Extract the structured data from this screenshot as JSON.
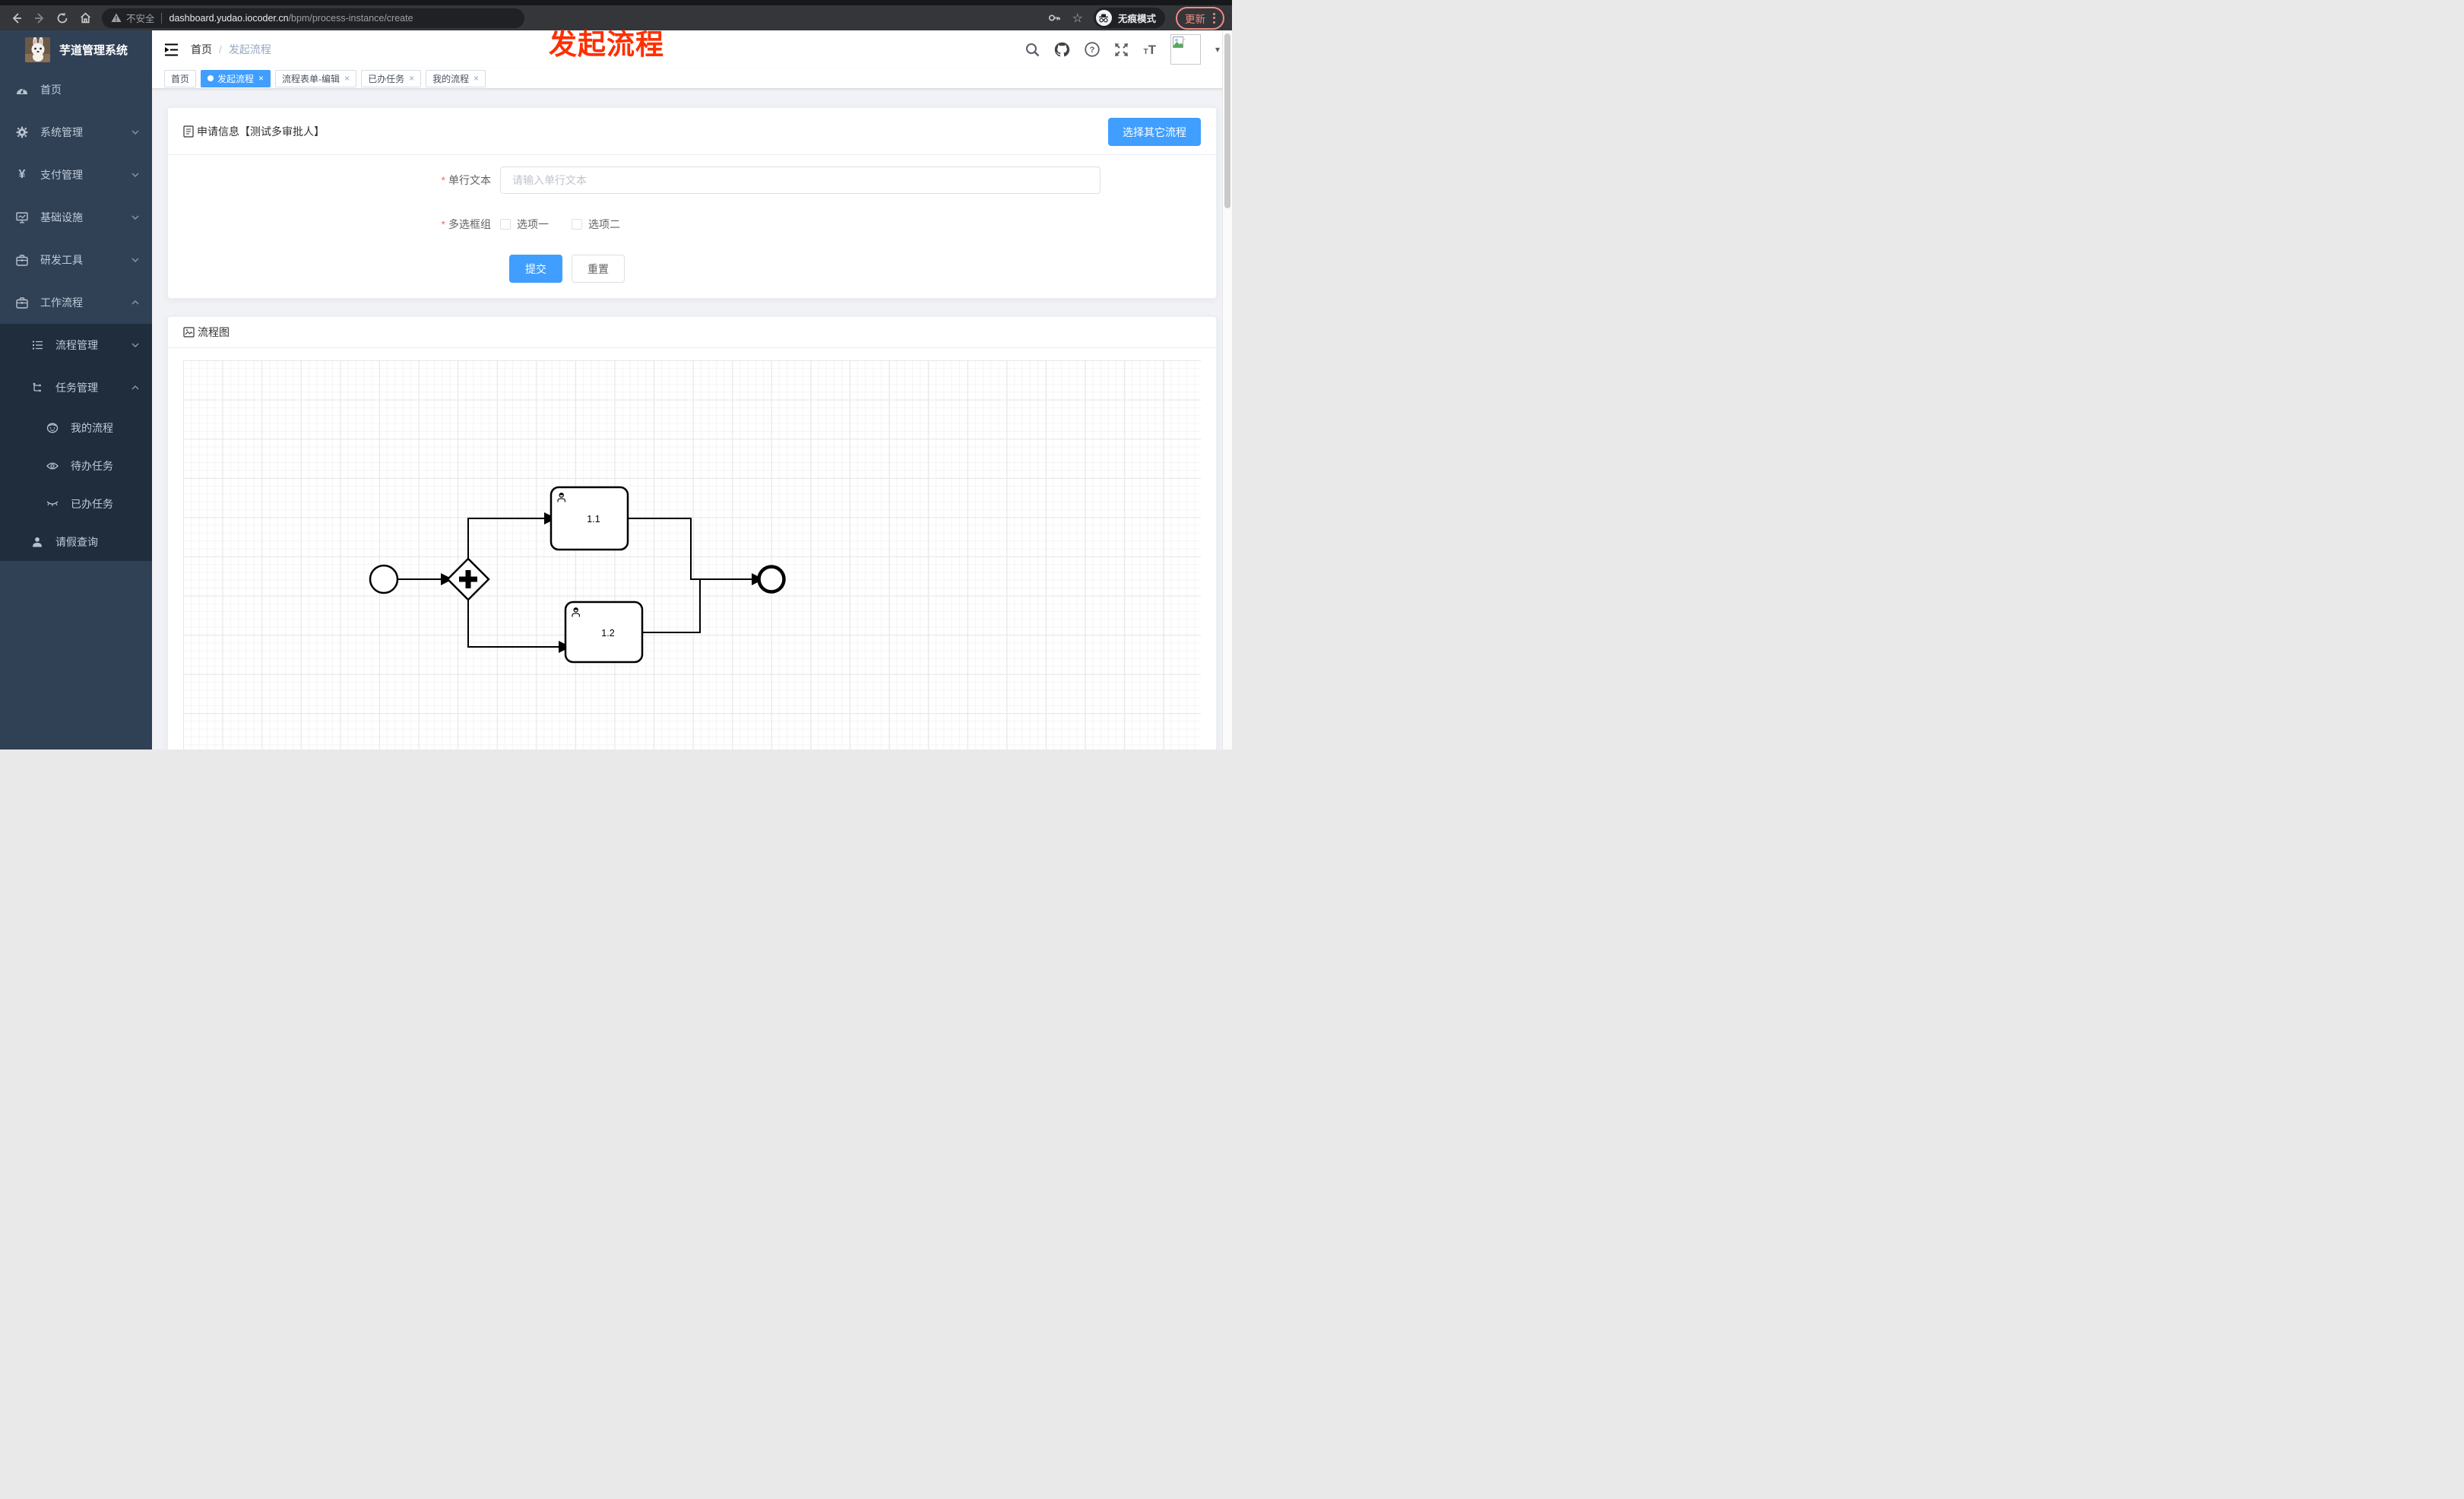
{
  "browser": {
    "security_label": "不安全",
    "url_domain": "dashboard.yudao.iocoder.cn",
    "url_path": "/bpm/process-instance/create",
    "incognito_label": "无痕模式",
    "update_label": "更新",
    "star_glyph": "☆"
  },
  "annotation": "发起流程",
  "sidebar": {
    "title": "芋道管理系统",
    "items": [
      {
        "label": "首页",
        "icon": "dashboard-icon"
      },
      {
        "label": "系统管理",
        "icon": "gear-icon"
      },
      {
        "label": "支付管理",
        "icon": "yen-icon"
      },
      {
        "label": "基础设施",
        "icon": "monitor-icon"
      },
      {
        "label": "研发工具",
        "icon": "briefcase-icon"
      },
      {
        "label": "工作流程",
        "icon": "briefcase-icon"
      }
    ],
    "yen_glyph": "¥",
    "submenu": [
      {
        "label": "流程管理",
        "icon": "tree-list-icon"
      },
      {
        "label": "任务管理",
        "icon": "branch-icon"
      }
    ],
    "task_children": [
      {
        "label": "我的流程",
        "icon": "robot-face-icon"
      },
      {
        "label": "待办任务",
        "icon": "eye-open-icon"
      },
      {
        "label": "已办任务",
        "icon": "eye-closed-icon"
      }
    ],
    "leave_item": {
      "label": "请假查询",
      "icon": "person-icon"
    }
  },
  "header": {
    "breadcrumb_home": "首页",
    "breadcrumb_sep": "/",
    "breadcrumb_current": "发起流程",
    "fontsize_glyph": "T",
    "caret_glyph": "▾",
    "help_glyph": "?"
  },
  "tabs": {
    "close_glyph": "×",
    "items": [
      {
        "label": "首页",
        "active": false,
        "closable": false
      },
      {
        "label": "发起流程",
        "active": true,
        "closable": true
      },
      {
        "label": "流程表单-编辑",
        "active": false,
        "closable": true
      },
      {
        "label": "已办任务",
        "active": false,
        "closable": true
      },
      {
        "label": "我的流程",
        "active": false,
        "closable": true
      }
    ]
  },
  "form_card": {
    "title": "申请信息【测试多审批人】",
    "choose_button": "选择其它流程",
    "required_marker": "*",
    "text_field": {
      "label": "单行文本",
      "placeholder": "请输入单行文本",
      "value": ""
    },
    "checkbox_field": {
      "label": "多选框组",
      "options": [
        {
          "label": "选项一",
          "checked": false
        },
        {
          "label": "选项二",
          "checked": false
        }
      ]
    },
    "submit_label": "提交",
    "reset_label": "重置"
  },
  "diagram_card": {
    "title": "流程图",
    "nodes": {
      "task1_label": "1.1",
      "task2_label": "1.2"
    }
  },
  "colors": {
    "accent": "#409eff",
    "annotation_red": "#ff2f00",
    "sidebar_bg": "#304156",
    "submenu_bg": "#1f2d3d",
    "chrome_bg": "#35363a",
    "urlbar_bg": "#202124",
    "update_salmon": "#f28b82"
  }
}
